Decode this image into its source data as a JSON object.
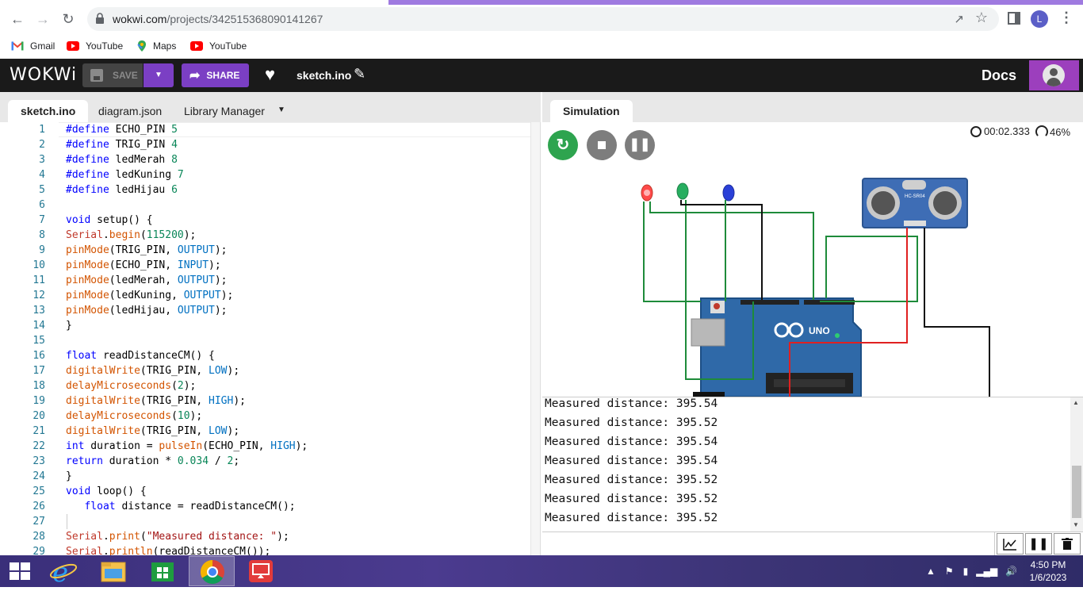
{
  "browser": {
    "url_host": "wokwi.com",
    "url_path": "/projects/342515368090141267",
    "profile_initial": "L",
    "bookmarks": [
      {
        "label": "Gmail",
        "icon": "gmail-icon"
      },
      {
        "label": "YouTube",
        "icon": "youtube-icon"
      },
      {
        "label": "Maps",
        "icon": "maps-icon"
      },
      {
        "label": "YouTube",
        "icon": "youtube-icon"
      }
    ]
  },
  "header": {
    "logo": "WOKWi",
    "save_label": "SAVE",
    "share_label": "SHARE",
    "file_title": "sketch.ino",
    "docs_label": "Docs"
  },
  "editor": {
    "tabs": [
      "sketch.ino",
      "diagram.json",
      "Library Manager"
    ],
    "active_tab": "sketch.ino",
    "lines": [
      "#define ECHO_PIN 5",
      "#define TRIG_PIN 4",
      "#define ledMerah 8",
      "#define ledKuning 7",
      "#define ledHijau 6",
      "",
      "void setup() {",
      "Serial.begin(115200);",
      "pinMode(TRIG_PIN, OUTPUT);",
      "pinMode(ECHO_PIN, INPUT);",
      "pinMode(ledMerah, OUTPUT);",
      "pinMode(ledKuning, OUTPUT);",
      "pinMode(ledHijau, OUTPUT);",
      "}",
      "",
      "float readDistanceCM() {",
      "digitalWrite(TRIG_PIN, LOW);",
      "delayMicroseconds(2);",
      "digitalWrite(TRIG_PIN, HIGH);",
      "delayMicroseconds(10);",
      "digitalWrite(TRIG_PIN, LOW);",
      "int duration = pulseIn(ECHO_PIN, HIGH);",
      "return duration * 0.034 / 2;",
      "}",
      "void loop() {",
      "   float distance = readDistanceCM();",
      "",
      "Serial.print(\"Measured distance: \");",
      "Serial.println(readDistanceCM());"
    ]
  },
  "simulation": {
    "tab_label": "Simulation",
    "elapsed": "00:02.333",
    "speed": "46%",
    "board_label": "UNO",
    "sensor_label": "HC-SR04",
    "serial_lines": [
      "Measured distance: 395.54",
      "Measured distance: 395.52",
      "Measured distance: 395.54",
      "Measured distance: 395.54",
      "Measured distance: 395.52",
      "Measured distance: 395.52",
      "Measured distance: 395.52"
    ],
    "serial_input_value": ""
  },
  "taskbar": {
    "time": "4:50 PM",
    "date": "1/6/2023",
    "apps": [
      "Internet Explorer",
      "File Explorer",
      "Store",
      "Google Chrome",
      "XinDawn"
    ]
  },
  "colors": {
    "wokwi_purple": "#7b3fc4",
    "header_bg": "#1a1a1a",
    "run_green": "#2ea44f"
  }
}
